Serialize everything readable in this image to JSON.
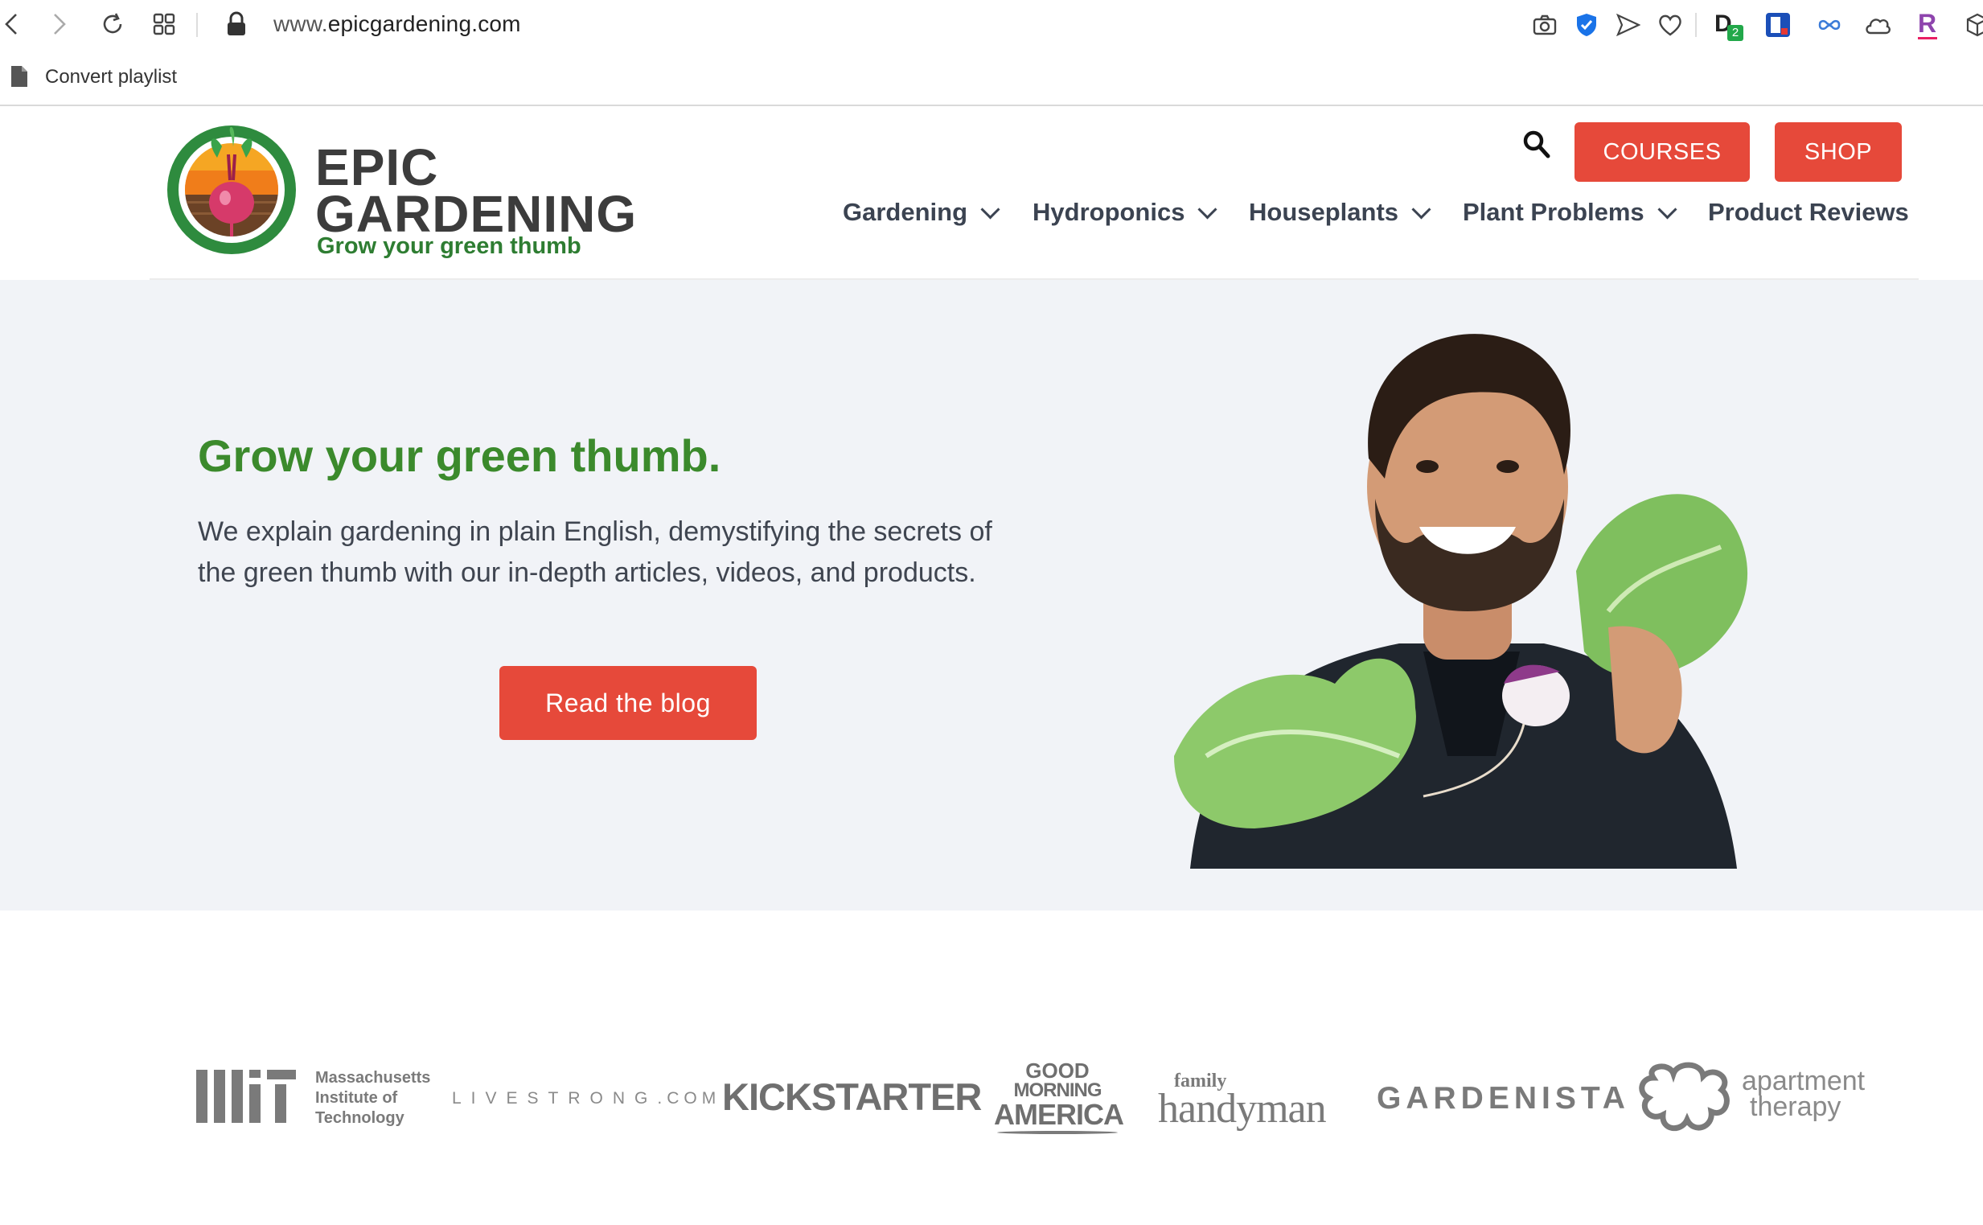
{
  "browser": {
    "url_prefix": "www.",
    "url_domain": "epicgardening.com",
    "bookmark_label": "Convert playlist",
    "extension_badge": "2",
    "icons": [
      "back-icon",
      "forward-icon",
      "reload-icon",
      "tabs-grid-icon",
      "lock-icon",
      "camera-icon",
      "shield-check-icon",
      "send-icon",
      "heart-icon",
      "extension-d-icon",
      "extension-t-icon",
      "extension-link-icon",
      "cloud-icon",
      "extension-r-icon",
      "cube-icon"
    ]
  },
  "header": {
    "logo_line1": "EPIC",
    "logo_line2": "GARDENING",
    "logo_tagline": "Grow your green thumb",
    "courses_label": "COURSES",
    "shop_label": "SHOP",
    "menu": [
      {
        "label": "Gardening",
        "has_dropdown": true
      },
      {
        "label": "Hydroponics",
        "has_dropdown": true
      },
      {
        "label": "Houseplants",
        "has_dropdown": true
      },
      {
        "label": "Plant Problems",
        "has_dropdown": true
      },
      {
        "label": "Product Reviews",
        "has_dropdown": false
      }
    ]
  },
  "hero": {
    "title": "Grow your green thumb.",
    "description": "We explain gardening in plain English, demystifying the secrets of the green thumb with our in-depth articles, videos, and products.",
    "cta_label": "Read the blog"
  },
  "press": {
    "mit_l1": "Massachusetts",
    "mit_l2": "Institute of",
    "mit_l3": "Technology",
    "livestrong": "LIVESTRONG",
    "livestrong_suffix": ".COM",
    "kickstarter": "KICKSTARTER",
    "gma_l1": "GOOD",
    "gma_l2": "MORNING",
    "gma_l3": "AMERICA",
    "handyman_small": "family",
    "handyman_big": "handyman",
    "gardenista": "GARDENISTA",
    "apartment_l1": "apartment",
    "apartment_l2": "therapy"
  },
  "colors": {
    "brand_red": "#e6493a",
    "brand_green": "#3b8a2c",
    "hero_bg": "#f1f3f7"
  }
}
